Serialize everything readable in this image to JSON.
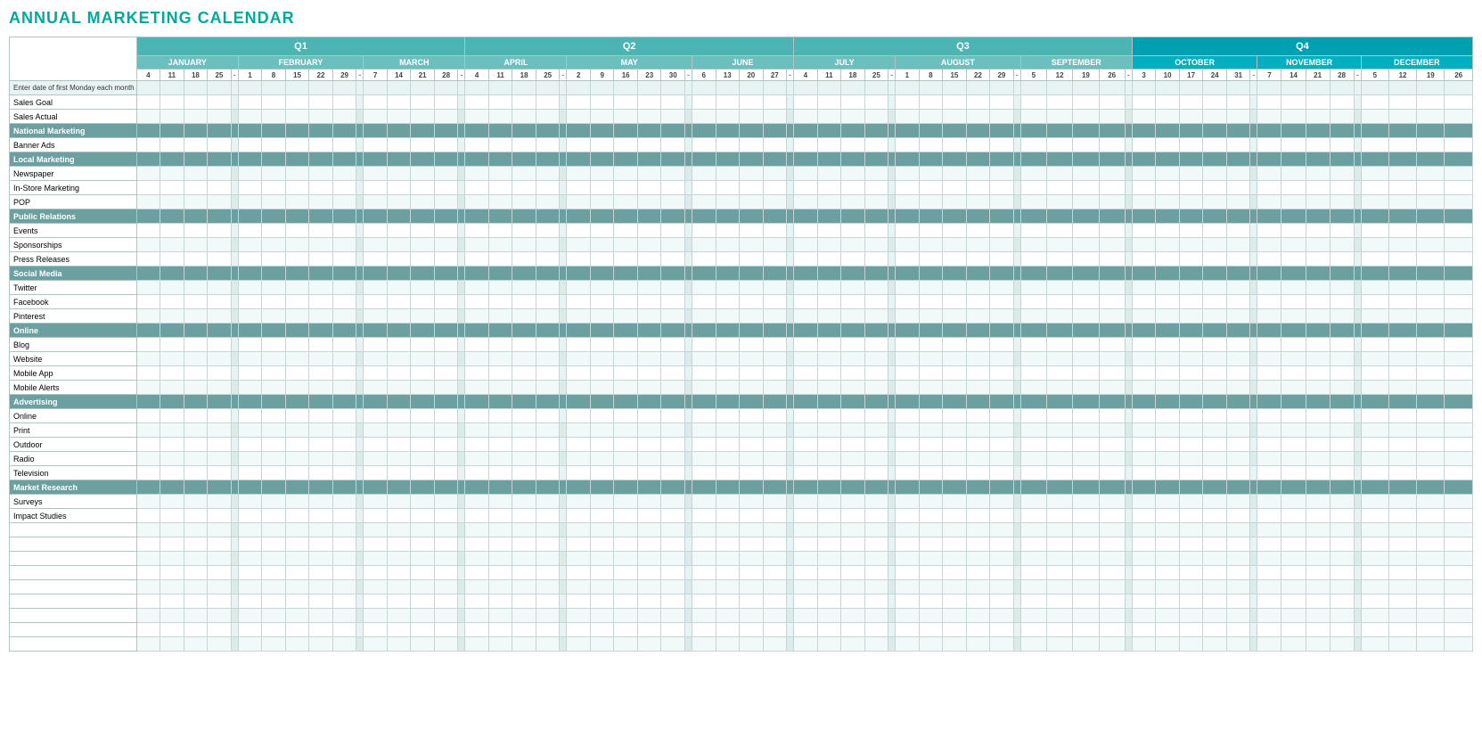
{
  "title": "ANNUAL MARKETING CALENDAR",
  "quarters": [
    {
      "label": "Q1",
      "span": 14
    },
    {
      "label": "Q2",
      "span": 13
    },
    {
      "label": "Q3",
      "span": 14
    },
    {
      "label": "Q4",
      "span": 13
    }
  ],
  "months": [
    {
      "label": "JANUARY",
      "cls": "jan",
      "days": [
        "4",
        "11",
        "18",
        "25"
      ],
      "sep": true
    },
    {
      "label": "FEBRUARY",
      "cls": "feb",
      "days": [
        "1",
        "8",
        "15",
        "22",
        "29"
      ],
      "sep": true
    },
    {
      "label": "MARCH",
      "cls": "mar",
      "days": [
        "7",
        "14",
        "21",
        "28"
      ],
      "sep": true
    },
    {
      "label": "APRIL",
      "cls": "apr",
      "days": [
        "4",
        "11",
        "18",
        "25"
      ],
      "sep": true
    },
    {
      "label": "MAY",
      "cls": "may",
      "days": [
        "2",
        "9",
        "16",
        "23",
        "30"
      ],
      "sep": true
    },
    {
      "label": "JUNE",
      "cls": "jun",
      "days": [
        "6",
        "13",
        "20",
        "27"
      ],
      "sep": true
    },
    {
      "label": "JULY",
      "cls": "jul",
      "days": [
        "4",
        "11",
        "18",
        "25"
      ],
      "sep": true
    },
    {
      "label": "AUGUST",
      "cls": "aug",
      "days": [
        "1",
        "8",
        "15",
        "22",
        "29"
      ],
      "sep": true
    },
    {
      "label": "SEPTEMBER",
      "cls": "sep",
      "days": [
        "5",
        "12",
        "19",
        "26"
      ],
      "sep": true
    },
    {
      "label": "OCTOBER",
      "cls": "oct",
      "days": [
        "3",
        "10",
        "17",
        "24",
        "31"
      ],
      "sep": true
    },
    {
      "label": "NOVEMBER",
      "cls": "nov",
      "days": [
        "7",
        "14",
        "21",
        "28"
      ],
      "sep": true
    },
    {
      "label": "DECEMBER",
      "cls": "dec",
      "days": [
        "5",
        "12",
        "19",
        "26"
      ],
      "sep": false
    }
  ],
  "enter_date_label": "Enter date of first Monday each month",
  "rows": [
    {
      "label": "Sales Goal",
      "type": "data"
    },
    {
      "label": "Sales Actual",
      "type": "data"
    },
    {
      "label": "National Marketing",
      "type": "category"
    },
    {
      "label": "Banner Ads",
      "type": "data"
    },
    {
      "label": "Local Marketing",
      "type": "category"
    },
    {
      "label": "Newspaper",
      "type": "data"
    },
    {
      "label": "In-Store Marketing",
      "type": "data"
    },
    {
      "label": "POP",
      "type": "data"
    },
    {
      "label": "Public Relations",
      "type": "category"
    },
    {
      "label": "Events",
      "type": "data"
    },
    {
      "label": "Sponsorships",
      "type": "data"
    },
    {
      "label": "Press Releases",
      "type": "data"
    },
    {
      "label": "Social Media",
      "type": "category"
    },
    {
      "label": "Twitter",
      "type": "data"
    },
    {
      "label": "Facebook",
      "type": "data"
    },
    {
      "label": "Pinterest",
      "type": "data"
    },
    {
      "label": "Online",
      "type": "category"
    },
    {
      "label": "Blog",
      "type": "data"
    },
    {
      "label": "Website",
      "type": "data"
    },
    {
      "label": "Mobile App",
      "type": "data"
    },
    {
      "label": "Mobile Alerts",
      "type": "data"
    },
    {
      "label": "Advertising",
      "type": "category"
    },
    {
      "label": "Online",
      "type": "data"
    },
    {
      "label": "Print",
      "type": "data"
    },
    {
      "label": "Outdoor",
      "type": "data"
    },
    {
      "label": "Radio",
      "type": "data"
    },
    {
      "label": "Television",
      "type": "data"
    },
    {
      "label": "Market Research",
      "type": "category"
    },
    {
      "label": "Surveys",
      "type": "data"
    },
    {
      "label": "Impact Studies",
      "type": "data"
    },
    {
      "label": "",
      "type": "data"
    },
    {
      "label": "",
      "type": "data"
    },
    {
      "label": "",
      "type": "data"
    },
    {
      "label": "",
      "type": "data"
    },
    {
      "label": "",
      "type": "data"
    },
    {
      "label": "",
      "type": "data"
    },
    {
      "label": "",
      "type": "data"
    },
    {
      "label": "",
      "type": "data"
    },
    {
      "label": "",
      "type": "data"
    }
  ]
}
